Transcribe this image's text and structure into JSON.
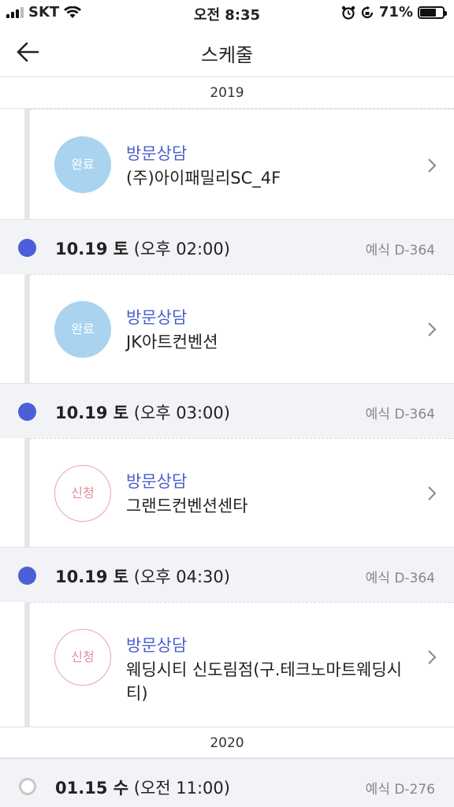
{
  "status_bar": {
    "carrier": "SKT",
    "time": "오전 8:35",
    "battery_percent": "71%",
    "battery_level": 0.71
  },
  "header": {
    "title": "스케줄",
    "back_icon": "back-arrow-icon"
  },
  "years": [
    "2019",
    "2020"
  ],
  "schedule": [
    {
      "badge": "완료",
      "badge_type": "done",
      "type": "방문상담",
      "place": "(주)아이패밀리SC_4F"
    },
    {
      "date": "10.19 토",
      "time": "(오후 02:00)",
      "dday": "예식 D-364",
      "badge": "완료",
      "badge_type": "done",
      "type": "방문상담",
      "place": "JK아트컨벤션"
    },
    {
      "date": "10.19 토",
      "time": "(오후 03:00)",
      "dday": "예식 D-364",
      "badge": "신청",
      "badge_type": "request",
      "type": "방문상담",
      "place": "그랜드컨벤션센타"
    },
    {
      "date": "10.19 토",
      "time": "(오후 04:30)",
      "dday": "예식 D-364",
      "badge": "신청",
      "badge_type": "request",
      "type": "방문상담",
      "place": "웨딩시티 신도림점(구.테크노마트웨딩시티)"
    },
    {
      "date": "01.15 수",
      "time": "(오전 11:00)",
      "dday": "예식 D-276"
    }
  ],
  "colors": {
    "accent": "#4a5fd8",
    "done_badge": "#a9d3ef",
    "request_badge_border": "#e7a2ae"
  }
}
